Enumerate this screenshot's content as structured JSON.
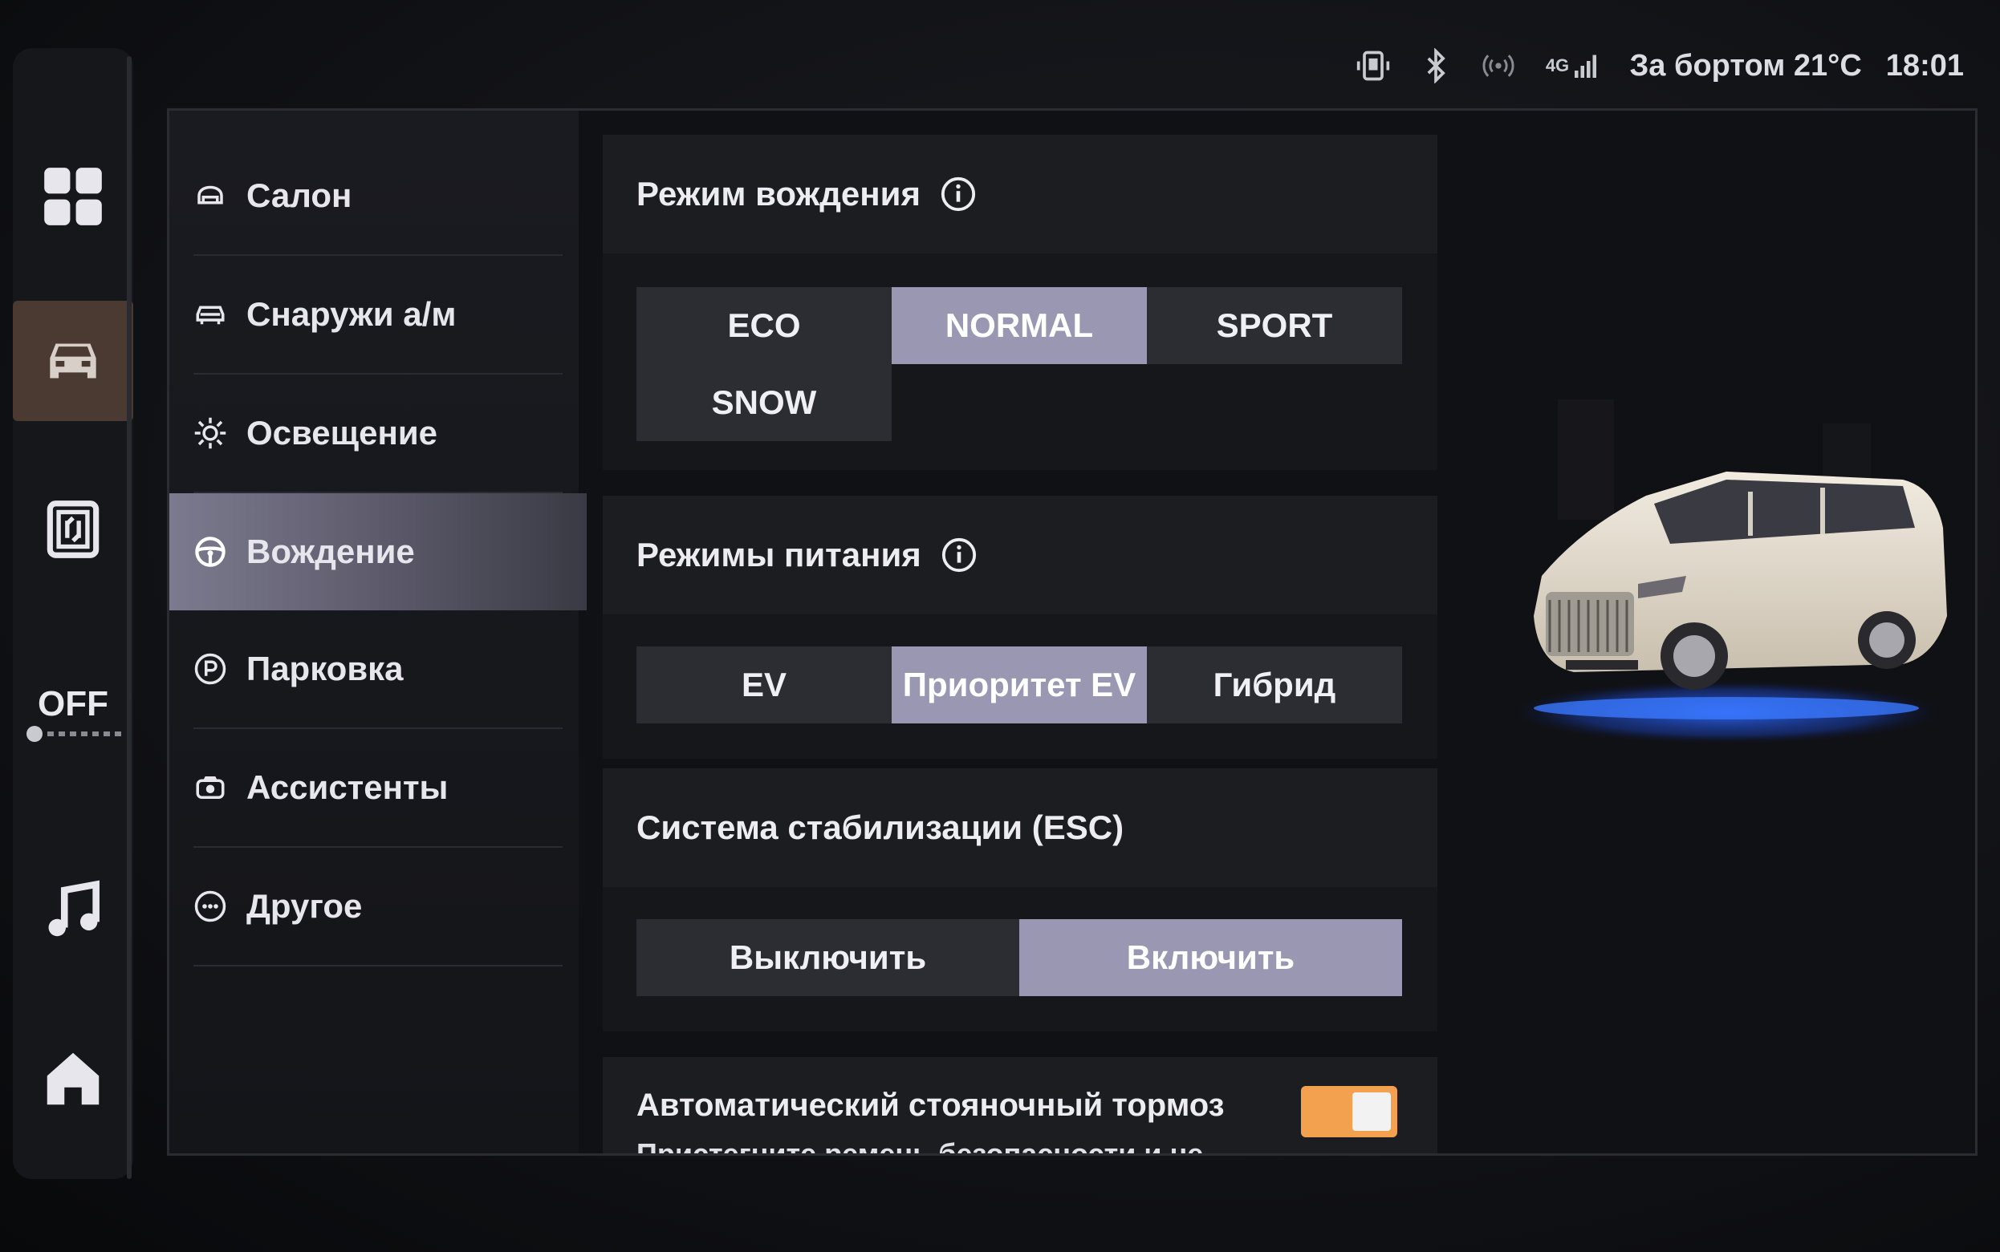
{
  "status": {
    "icons": [
      "phone-projection-icon",
      "bluetooth-icon",
      "wireless-signal-icon",
      "cellular-4g-icon"
    ],
    "network_label": "4G",
    "temperature": "За бортом 21°C",
    "time": "18:01"
  },
  "dock": {
    "items": [
      {
        "name": "apps-grid-icon"
      },
      {
        "name": "car-icon",
        "active": true
      },
      {
        "name": "manual-book-icon"
      },
      {
        "name": "climate-fan-icon",
        "label": "OFF"
      },
      {
        "name": "music-note-icon"
      },
      {
        "name": "home-icon"
      }
    ]
  },
  "menu": {
    "items": [
      {
        "label": "Салон",
        "icon": "cabin-icon"
      },
      {
        "label": "Снаружи а/м",
        "icon": "car-exterior-icon"
      },
      {
        "label": "Освещение",
        "icon": "sun-light-icon"
      },
      {
        "label": "Вождение",
        "icon": "steering-wheel-icon",
        "active": true
      },
      {
        "label": "Парковка",
        "icon": "parking-icon"
      },
      {
        "label": "Ассистенты",
        "icon": "assistant-camera-icon"
      },
      {
        "label": "Другое",
        "icon": "more-dots-icon"
      }
    ]
  },
  "driving_mode": {
    "title": "Режим вождения",
    "options": [
      "ECO",
      "NORMAL",
      "SPORT",
      "SNOW"
    ],
    "selected": "NORMAL"
  },
  "power_mode": {
    "title": "Режимы питания",
    "options": [
      "EV",
      "Приоритет EV",
      "Гибрид"
    ],
    "selected": "Приоритет EV"
  },
  "esc": {
    "title": "Система стабилизации (ESC)",
    "options": [
      "Выключить",
      "Включить"
    ],
    "selected": "Включить"
  },
  "auto_brake": {
    "title": "Автоматический стояночный тормоз",
    "description": "Пристегните ремень безопасности и не",
    "enabled": true
  },
  "colors": {
    "accent_selected": "#9a97b2",
    "toggle_on": "#f3a14e",
    "dock_active": "#4a3a31",
    "car_glow": "#2f6bff"
  }
}
